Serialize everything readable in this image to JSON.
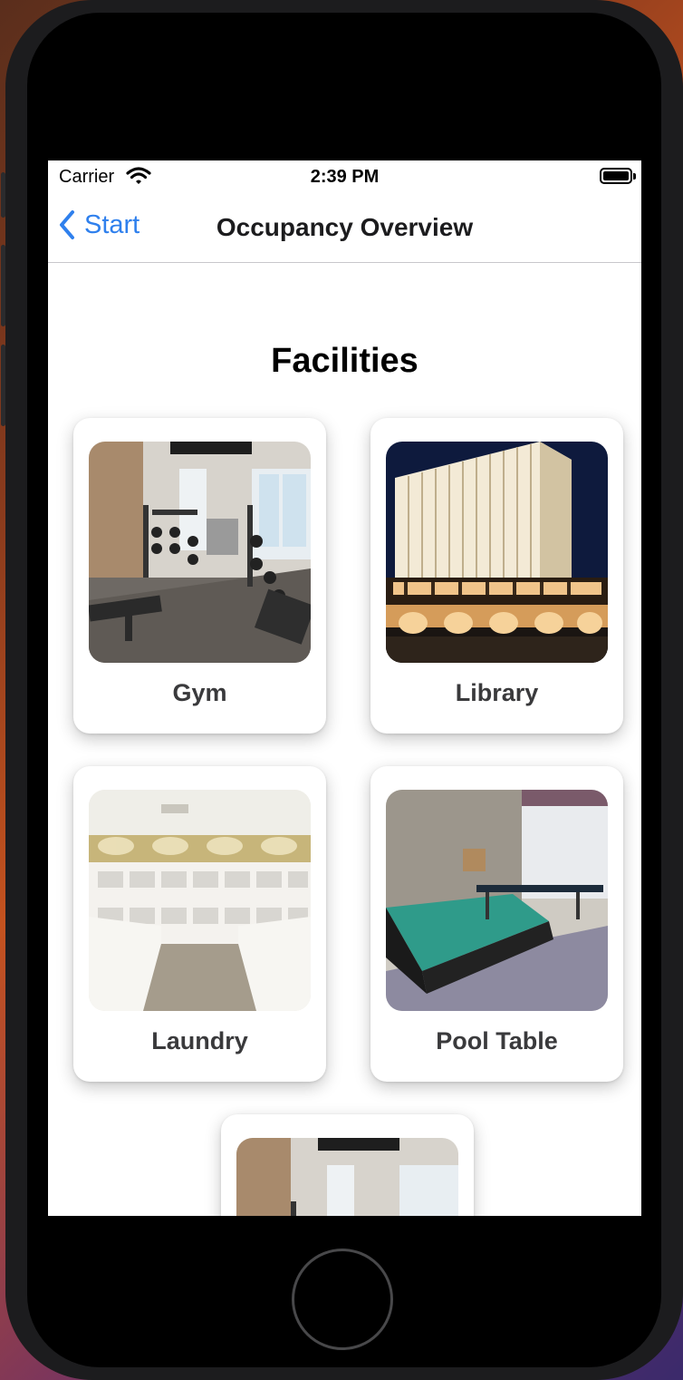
{
  "status_bar": {
    "carrier": "Carrier",
    "time": "2:39 PM"
  },
  "nav": {
    "back_label": "Start",
    "title": "Occupancy Overview"
  },
  "section_title": "Facilities",
  "facilities": [
    {
      "label": "Gym",
      "image": "gym-photo"
    },
    {
      "label": "Library",
      "image": "library-photo"
    },
    {
      "label": "Laundry",
      "image": "laundry-photo"
    },
    {
      "label": "Pool Table",
      "image": "pool-table-photo"
    },
    {
      "label": "",
      "image": "gym-photo"
    }
  ],
  "colors": {
    "accent": "#2f80ed",
    "card_bg": "#ffffff",
    "text": "#3a3a3c"
  }
}
